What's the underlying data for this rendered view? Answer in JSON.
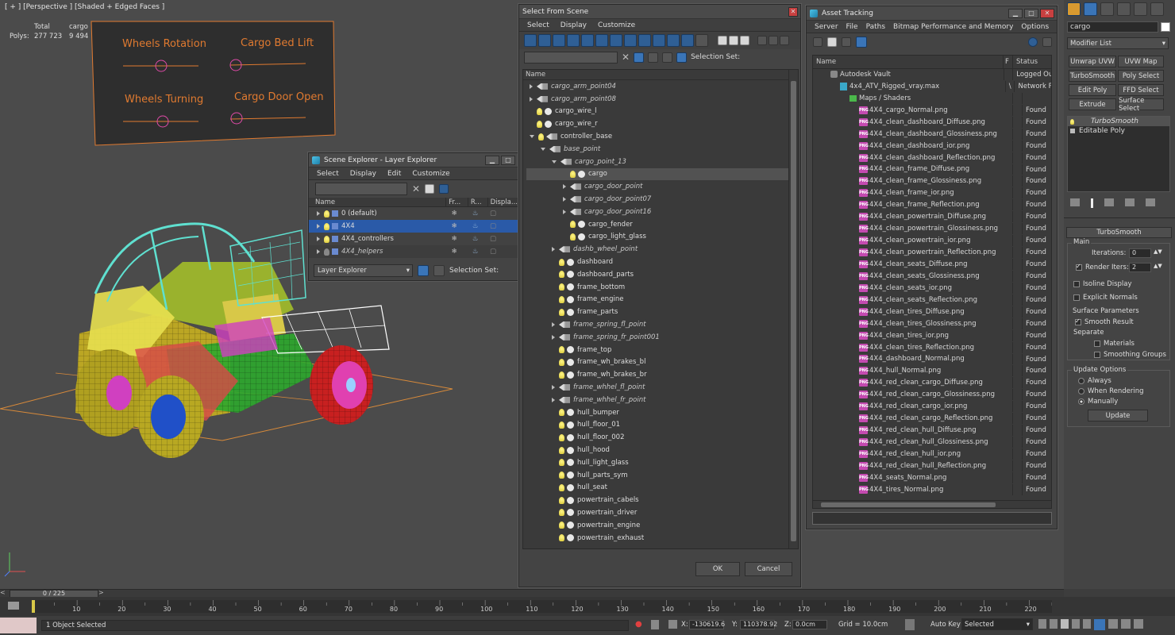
{
  "viewport": {
    "label": "[ + ] [Perspective ] [Shaded + Edged Faces ]",
    "stats": {
      "col_total": "Total",
      "col_obj": "cargo",
      "row_label": "Polys:",
      "total": "277 723",
      "obj": "9 494"
    },
    "sliders": [
      {
        "label": "Wheels Rotation"
      },
      {
        "label": "Cargo Bed Lift"
      },
      {
        "label": "Wheels Turning"
      },
      {
        "label": "Cargo Door Open"
      }
    ],
    "colors": {
      "bg": "#4b4b4b",
      "frame": "#e07a30",
      "knob": "#e04aa8"
    }
  },
  "layer_explorer": {
    "title": "Scene Explorer - Layer Explorer",
    "menu": [
      "Select",
      "Display",
      "Edit",
      "Customize"
    ],
    "columns": [
      "Name",
      "Fr...",
      "R...",
      "Displa..."
    ],
    "rows": [
      {
        "name": "0 (default)",
        "selected": false,
        "italic": false
      },
      {
        "name": "4X4",
        "selected": true,
        "italic": false
      },
      {
        "name": "4X4_controllers",
        "selected": false,
        "italic": false
      },
      {
        "name": "4X4_helpers",
        "selected": false,
        "italic": true
      }
    ],
    "footer_dropdown": "Layer Explorer",
    "selection_set_label": "Selection Set:"
  },
  "select_from_scene": {
    "title": "Select From Scene",
    "menu": [
      "Select",
      "Display",
      "Customize"
    ],
    "selection_set_label": "Selection Set:",
    "column": "Name",
    "rows": [
      {
        "name": "cargo_arm_point04",
        "indent": 0,
        "type": "grp",
        "arrow": "closed",
        "italic": true
      },
      {
        "name": "cargo_arm_point08",
        "indent": 0,
        "type": "grp",
        "arrow": "closed",
        "italic": true
      },
      {
        "name": "cargo_wire_l",
        "indent": 0,
        "type": "obj",
        "arrow": "none",
        "italic": false
      },
      {
        "name": "cargo_wire_r",
        "indent": 0,
        "type": "obj",
        "arrow": "none",
        "italic": false
      },
      {
        "name": "controller_base",
        "indent": 0,
        "type": "ctrl",
        "arrow": "open",
        "italic": false
      },
      {
        "name": "base_point",
        "indent": 1,
        "type": "grp",
        "arrow": "open",
        "italic": true
      },
      {
        "name": "cargo_point_13",
        "indent": 2,
        "type": "grp",
        "arrow": "open",
        "italic": true
      },
      {
        "name": "cargo",
        "indent": 3,
        "type": "obj",
        "arrow": "none",
        "italic": false,
        "selected": true
      },
      {
        "name": "cargo_door_point",
        "indent": 3,
        "type": "grp",
        "arrow": "closed",
        "italic": true
      },
      {
        "name": "cargo_door_point07",
        "indent": 3,
        "type": "grp",
        "arrow": "closed",
        "italic": true
      },
      {
        "name": "cargo_door_point16",
        "indent": 3,
        "type": "grp",
        "arrow": "closed",
        "italic": true
      },
      {
        "name": "cargo_fender",
        "indent": 3,
        "type": "obj",
        "arrow": "none",
        "italic": false
      },
      {
        "name": "cargo_light_glass",
        "indent": 3,
        "type": "obj",
        "arrow": "none",
        "italic": false
      },
      {
        "name": "dashb_wheel_point",
        "indent": 2,
        "type": "grp",
        "arrow": "closed",
        "italic": true
      },
      {
        "name": "dashboard",
        "indent": 2,
        "type": "obj",
        "arrow": "none",
        "italic": false
      },
      {
        "name": "dashboard_parts",
        "indent": 2,
        "type": "obj",
        "arrow": "none",
        "italic": false
      },
      {
        "name": "frame_bottom",
        "indent": 2,
        "type": "obj",
        "arrow": "none",
        "italic": false
      },
      {
        "name": "frame_engine",
        "indent": 2,
        "type": "obj",
        "arrow": "none",
        "italic": false
      },
      {
        "name": "frame_parts",
        "indent": 2,
        "type": "obj",
        "arrow": "none",
        "italic": false
      },
      {
        "name": "frame_spring_fl_point",
        "indent": 2,
        "type": "grp",
        "arrow": "closed",
        "italic": true
      },
      {
        "name": "frame_spring_fr_point001",
        "indent": 2,
        "type": "grp",
        "arrow": "closed",
        "italic": true
      },
      {
        "name": "frame_top",
        "indent": 2,
        "type": "obj",
        "arrow": "none",
        "italic": false
      },
      {
        "name": "frame_wh_brakes_bl",
        "indent": 2,
        "type": "obj",
        "arrow": "none",
        "italic": false
      },
      {
        "name": "frame_wh_brakes_br",
        "indent": 2,
        "type": "obj",
        "arrow": "none",
        "italic": false
      },
      {
        "name": "frame_whhel_fl_point",
        "indent": 2,
        "type": "grp",
        "arrow": "closed",
        "italic": true
      },
      {
        "name": "frame_whhel_fr_point",
        "indent": 2,
        "type": "grp",
        "arrow": "closed",
        "italic": true
      },
      {
        "name": "hull_bumper",
        "indent": 2,
        "type": "obj",
        "arrow": "none",
        "italic": false
      },
      {
        "name": "hull_floor_01",
        "indent": 2,
        "type": "obj",
        "arrow": "none",
        "italic": false
      },
      {
        "name": "hull_floor_002",
        "indent": 2,
        "type": "obj",
        "arrow": "none",
        "italic": false
      },
      {
        "name": "hull_hood",
        "indent": 2,
        "type": "obj",
        "arrow": "none",
        "italic": false
      },
      {
        "name": "hull_light_glass",
        "indent": 2,
        "type": "obj",
        "arrow": "none",
        "italic": false
      },
      {
        "name": "hull_parts_sym",
        "indent": 2,
        "type": "obj",
        "arrow": "none",
        "italic": false
      },
      {
        "name": "hull_seat",
        "indent": 2,
        "type": "obj",
        "arrow": "none",
        "italic": false
      },
      {
        "name": "powertrain_cabels",
        "indent": 2,
        "type": "obj",
        "arrow": "none",
        "italic": false
      },
      {
        "name": "powertrain_driver",
        "indent": 2,
        "type": "obj",
        "arrow": "none",
        "italic": false
      },
      {
        "name": "powertrain_engine",
        "indent": 2,
        "type": "obj",
        "arrow": "none",
        "italic": false
      },
      {
        "name": "powertrain_exhaust",
        "indent": 2,
        "type": "obj",
        "arrow": "none",
        "italic": false
      }
    ],
    "ok_label": "OK",
    "cancel_label": "Cancel"
  },
  "asset_tracking": {
    "title": "Asset Tracking",
    "menu": [
      "Server",
      "File",
      "Paths",
      "Bitmap Performance and Memory",
      "Options"
    ],
    "columns": [
      "Name",
      "F",
      "Status"
    ],
    "tree": [
      {
        "name": "Autodesk Vault",
        "indent": 0,
        "icon": "vault",
        "f": "",
        "status": "Logged Ou"
      },
      {
        "name": "4x4_ATV_Rigged_vray.max",
        "indent": 1,
        "icon": "max",
        "f": "\\",
        "status": "Network P"
      },
      {
        "name": "Maps / Shaders",
        "indent": 2,
        "icon": "maps",
        "f": "",
        "status": ""
      }
    ],
    "files": [
      "4X4_cargo_Normal.png",
      "4X4_clean_dashboard_Diffuse.png",
      "4X4_clean_dashboard_Glossiness.png",
      "4X4_clean_dashboard_ior.png",
      "4X4_clean_dashboard_Reflection.png",
      "4X4_clean_frame_Diffuse.png",
      "4X4_clean_frame_Glossiness.png",
      "4X4_clean_frame_ior.png",
      "4X4_clean_frame_Reflection.png",
      "4X4_clean_powertrain_Diffuse.png",
      "4X4_clean_powertrain_Glossiness.png",
      "4X4_clean_powertrain_ior.png",
      "4X4_clean_powertrain_Reflection.png",
      "4X4_clean_seats_Diffuse.png",
      "4X4_clean_seats_Glossiness.png",
      "4X4_clean_seats_ior.png",
      "4X4_clean_seats_Reflection.png",
      "4X4_clean_tires_Diffuse.png",
      "4X4_clean_tires_Glossiness.png",
      "4X4_clean_tires_ior.png",
      "4X4_clean_tires_Reflection.png",
      "4X4_dashboard_Normal.png",
      "4X4_hull_Normal.png",
      "4X4_red_clean_cargo_Diffuse.png",
      "4X4_red_clean_cargo_Glossiness.png",
      "4X4_red_clean_cargo_ior.png",
      "4X4_red_clean_cargo_Reflection.png",
      "4X4_red_clean_hull_Diffuse.png",
      "4X4_red_clean_hull_Glossiness.png",
      "4X4_red_clean_hull_ior.png",
      "4X4_red_clean_hull_Reflection.png",
      "4X4_seats_Normal.png",
      "4X4_tires_Normal.png"
    ],
    "file_status": "Found",
    "file_icon_text": "PNG"
  },
  "command_panel": {
    "object_name": "cargo",
    "modifier_list": "Modifier List",
    "buttons": [
      "Unwrap UVW",
      "UVW Map",
      "TurboSmooth",
      "Poly Select",
      "Edit Poly",
      "FFD Select",
      "Extrude",
      "Surface Select"
    ],
    "stack": [
      {
        "name": "TurboSmooth",
        "italic": true
      },
      {
        "name": "Editable Poly",
        "italic": false
      }
    ],
    "rollout_title": "TurboSmooth",
    "main_label": "Main",
    "iterations_label": "Iterations:",
    "iterations_value": "0",
    "render_iters_label": "Render Iters:",
    "render_iters_value": "2",
    "isoline_label": "Isoline Display",
    "explicit_label": "Explicit Normals",
    "surface_label": "Surface Parameters",
    "smooth_result_label": "Smooth Result",
    "separate_label": "Separate",
    "materials_label": "Materials",
    "smoothing_label": "Smoothing Groups",
    "update_options_label": "Update Options",
    "always_label": "Always",
    "when_rendering_label": "When Rendering",
    "manually_label": "Manually",
    "update_button": "Update"
  },
  "timeline": {
    "frame_counter": "0 / 225",
    "ticks": [
      "10",
      "20",
      "30",
      "40",
      "50",
      "60",
      "70",
      "80",
      "90",
      "100",
      "110",
      "120",
      "130",
      "140",
      "150",
      "160",
      "170",
      "180",
      "190",
      "200",
      "210",
      "220"
    ]
  },
  "status_bar": {
    "status_text": "1 Object Selected",
    "x_label": "X:",
    "x_value": "-130619.6",
    "y_label": "Y:",
    "y_value": "110378.92",
    "z_label": "Z:",
    "z_value": "0.0cm",
    "grid": "Grid = 10.0cm",
    "auto_key": "Auto Key",
    "selected_dropdown": "Selected"
  }
}
